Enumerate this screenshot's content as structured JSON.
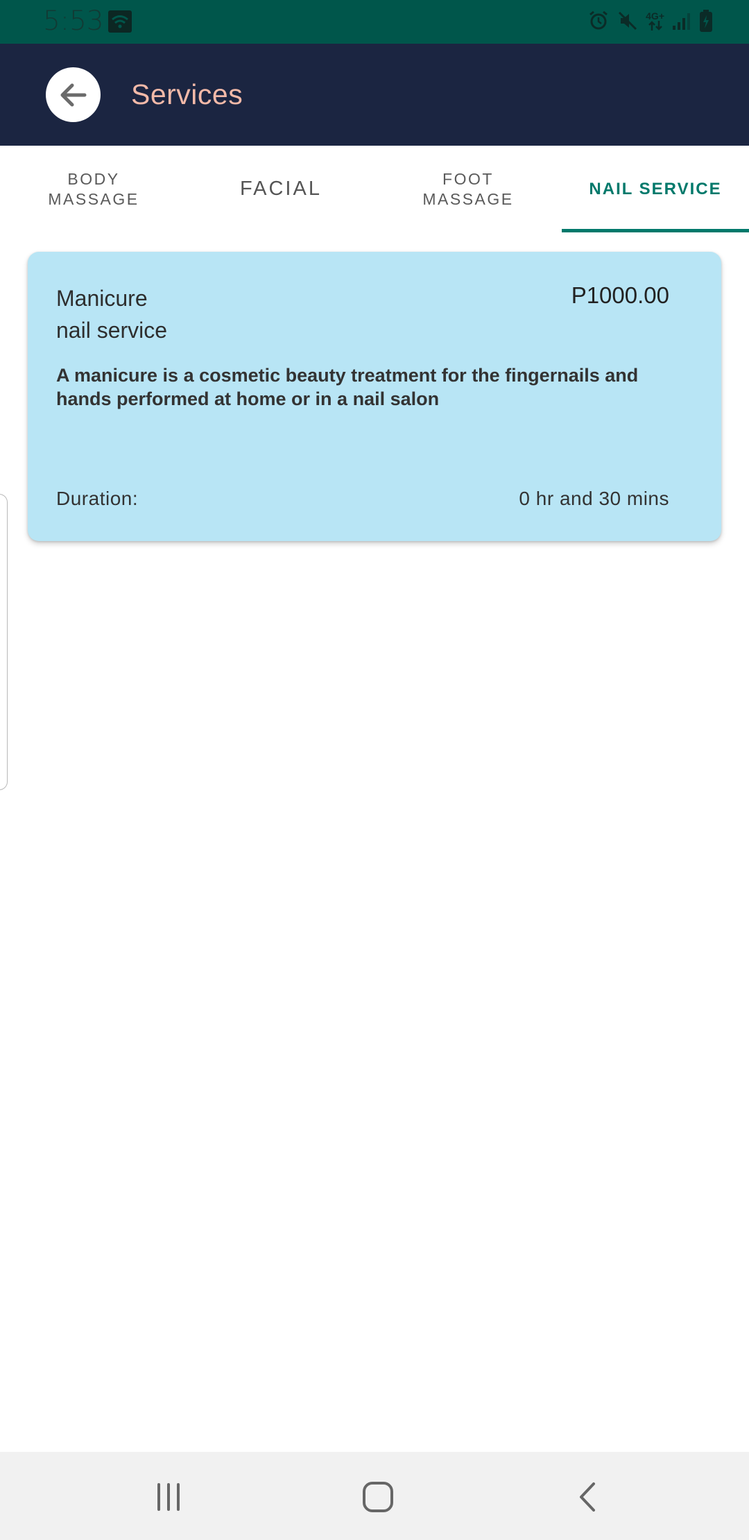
{
  "status_bar": {
    "time": "5:53",
    "network": "4G+",
    "icons": [
      "wifi-icon",
      "alarm-icon",
      "mute-icon",
      "signal-icon",
      "battery-charging-icon"
    ]
  },
  "app_bar": {
    "title": "Services",
    "back_icon": "arrow-back-icon",
    "colors": {
      "background": "#1b2541",
      "title": "#f2b9a8"
    }
  },
  "tabs": [
    {
      "label_line1": "BODY",
      "label_line2": "MASSAGE",
      "active": false
    },
    {
      "label_line1": "FACIAL",
      "label_line2": "",
      "active": false
    },
    {
      "label_line1": "FOOT",
      "label_line2": "MASSAGE",
      "active": false
    },
    {
      "label_line1": "NAIL SERVICE",
      "label_line2": "",
      "active": true
    }
  ],
  "service_card": {
    "name_line1": "Manicure",
    "name_line2": "nail service",
    "price": "P1000.00",
    "description": "A manicure is a cosmetic beauty treatment for the fingernails and hands performed at home or in a nail salon",
    "duration_label": "Duration:",
    "duration_value": "0 hr and 30 mins",
    "colors": {
      "background": "#b8e5f5"
    }
  },
  "nav_bar": {
    "icons": [
      "recent-apps-icon",
      "home-icon",
      "back-icon"
    ]
  },
  "colors": {
    "accent": "#00796b",
    "status_bar": "#00564b"
  }
}
